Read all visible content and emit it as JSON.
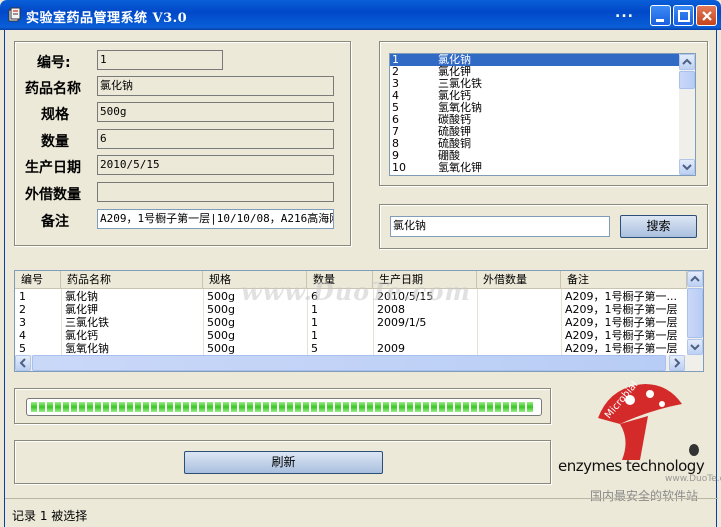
{
  "window": {
    "title": "实验室药品管理系统 V3.0",
    "dots": "...",
    "controls": [
      "minimize",
      "maximize",
      "close"
    ]
  },
  "form": {
    "fields": [
      {
        "label": "编号:",
        "value": "1"
      },
      {
        "label": "药品名称",
        "value": "氯化钠"
      },
      {
        "label": "规格",
        "value": "500g"
      },
      {
        "label": "数量",
        "value": "6"
      },
      {
        "label": "生产日期",
        "value": "2010/5/15"
      },
      {
        "label": "外借数量",
        "value": ""
      },
      {
        "label": "备注",
        "value": "A209，1号橱子第一层|10/10/08，A216高海刚"
      }
    ]
  },
  "drug_list": {
    "items": [
      {
        "num": "1",
        "name": "氯化钠",
        "selected": true
      },
      {
        "num": "2",
        "name": "氯化钾",
        "selected": false
      },
      {
        "num": "3",
        "name": "三氯化铁",
        "selected": false
      },
      {
        "num": "4",
        "name": "氯化钙",
        "selected": false
      },
      {
        "num": "5",
        "name": "氢氧化钠",
        "selected": false
      },
      {
        "num": "6",
        "name": "碳酸钙",
        "selected": false
      },
      {
        "num": "7",
        "name": "硫酸钾",
        "selected": false
      },
      {
        "num": "8",
        "name": "硫酸铜",
        "selected": false
      },
      {
        "num": "9",
        "name": "硼酸",
        "selected": false
      },
      {
        "num": "10",
        "name": "氢氧化钾",
        "selected": false
      }
    ]
  },
  "search": {
    "value": "氯化钠",
    "button_label": "搜索"
  },
  "table": {
    "columns": [
      "编号",
      "药品名称",
      "规格",
      "数量",
      "生产日期",
      "外借数量",
      "备注"
    ],
    "rows": [
      [
        "1",
        "氯化钠",
        "500g",
        "6",
        "2010/5/15",
        "",
        "A209，1号橱子第一..."
      ],
      [
        "2",
        "氯化钾",
        "500g",
        "1",
        "2008",
        "",
        "A209，1号橱子第一层"
      ],
      [
        "3",
        "三氯化铁",
        "500g",
        "1",
        "2009/1/5",
        "",
        "A209，1号橱子第一层"
      ],
      [
        "4",
        "氯化钙",
        "500g",
        "1",
        "",
        "",
        "A209，1号橱子第一层"
      ],
      [
        "5",
        "氢氧化钠",
        "500g",
        "5",
        "2009",
        "",
        "A209，1号橱子第一层"
      ]
    ]
  },
  "progress": {
    "fraction": 1.0
  },
  "refresh_button": "刷新",
  "status": "记录 1 被选择",
  "branding": {
    "watermark": "www.DuoTe.com",
    "logo_text": "enzymes technology",
    "logo_sub": "Microbial",
    "site_text": "国内最安全的软件站",
    "small_watermark": "www.DuoTe.com"
  },
  "colors": {
    "title_bar": "#0a5fd8",
    "selection": "#316ac5",
    "progress": "#37c523",
    "mushroom_red": "#d42a2a"
  }
}
